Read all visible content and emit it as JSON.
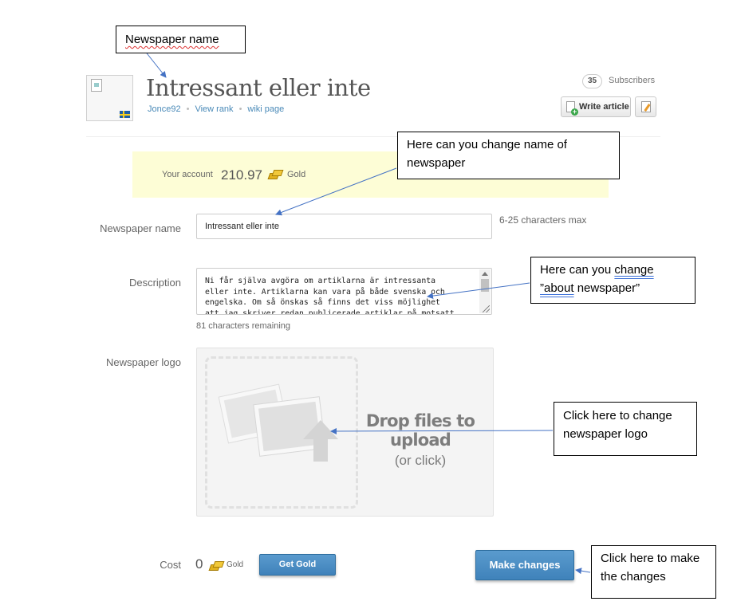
{
  "header": {
    "title": "Intressant eller inte",
    "owner": "Jonce92",
    "view_rank": "View rank",
    "wiki_page": "wiki page",
    "subscribers_count": "35",
    "subscribers_label": "Subscribers",
    "write_article": "Write article"
  },
  "account": {
    "label": "Your account",
    "value": "210.97",
    "currency": "Gold"
  },
  "form": {
    "name_label": "Newspaper name",
    "name_value": "Intressant eller inte",
    "name_hint": "6-25 characters max",
    "description_label": "Description",
    "description_value": "Ni får själva avgöra om artiklarna är intressanta\neller inte. Artiklarna kan vara på både svenska och\nengelska. Om så önskas så finns det viss möjlighet\natt jag skriver redan publicerade artiklar på motsatt",
    "description_remaining": "81 characters remaining",
    "logo_label": "Newspaper logo",
    "drop_title": "Drop files to upload",
    "drop_sub": "(or click)",
    "cost_label": "Cost",
    "cost_value": "0",
    "cost_currency": "Gold",
    "get_gold": "Get Gold",
    "make_changes": "Make changes"
  },
  "annotations": {
    "name_callout": "Newspaper name",
    "change_name_callout": "Here can you change name of newspaper",
    "about_callout_prefix": "Here can you ",
    "about_callout_change": "change",
    "about_callout_quote": "”",
    "about_callout_about": "about",
    "about_callout_suffix": " newspaper”",
    "logo_callout": "Click here to change newspaper logo",
    "make_changes_callout": "Click here to make the changes"
  },
  "colors": {
    "account_bg": "#fdfdd6",
    "button_blue": "#4a8cc2",
    "link_blue": "#4a8ab8",
    "annotation_arrow": "#4472c4"
  }
}
